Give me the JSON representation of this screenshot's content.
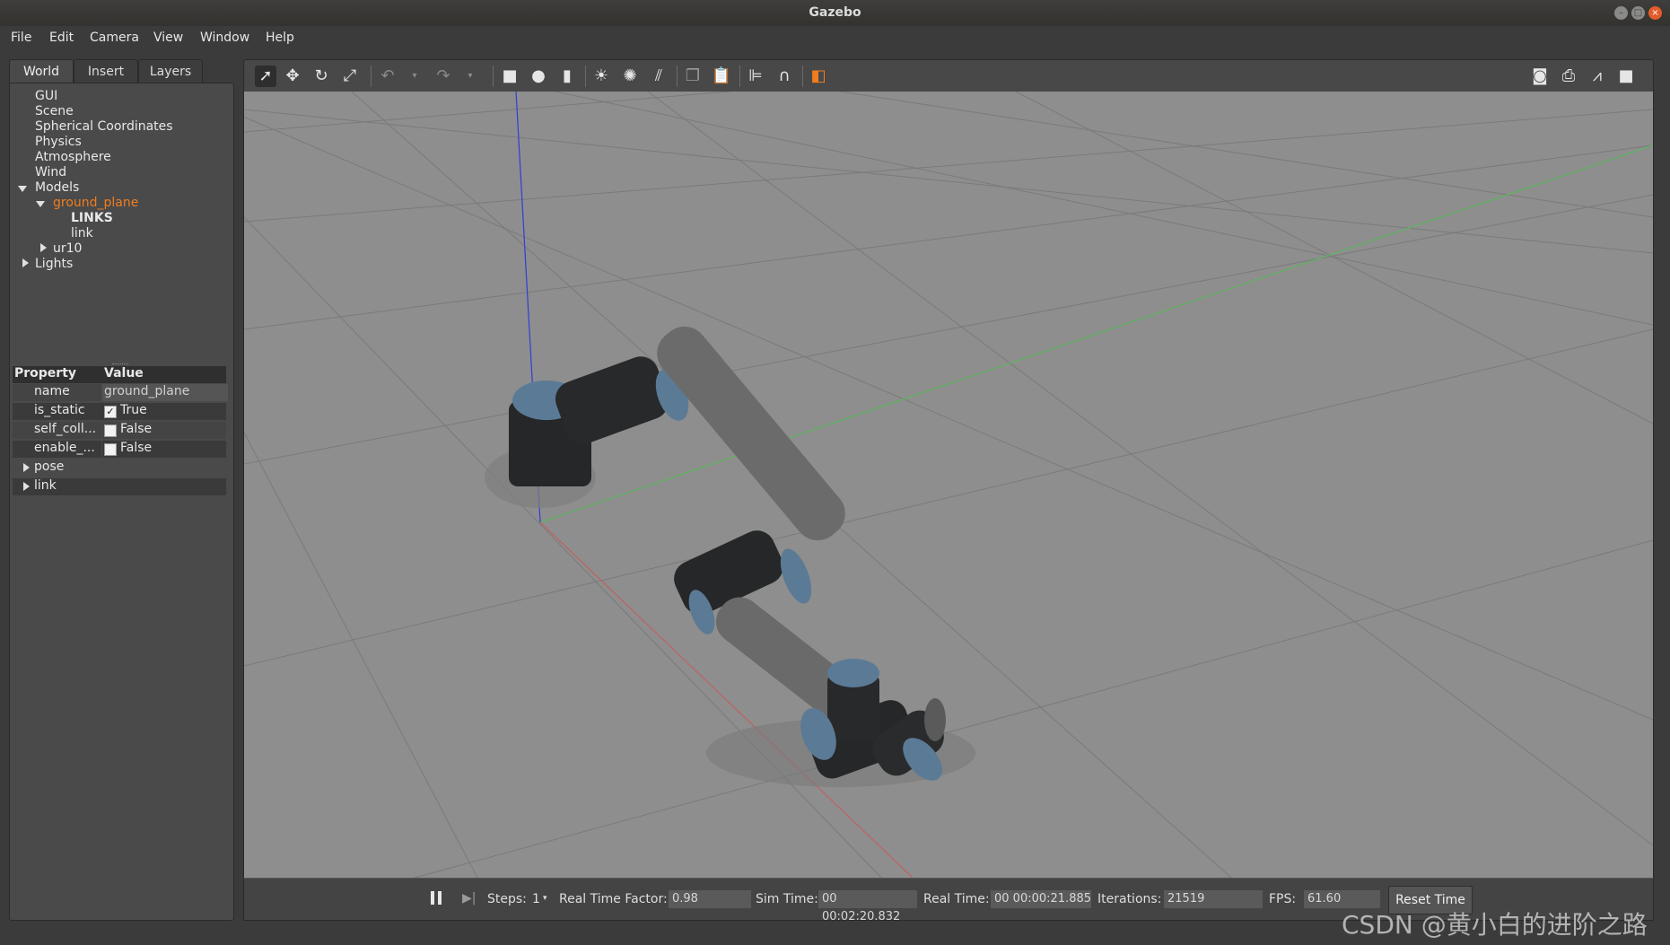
{
  "window": {
    "title": "Gazebo"
  },
  "menu": [
    "File",
    "Edit",
    "Camera",
    "View",
    "Window",
    "Help"
  ],
  "tabs": [
    "World",
    "Insert",
    "Layers"
  ],
  "tree": {
    "gui": "GUI",
    "scene": "Scene",
    "spherical": "Spherical Coordinates",
    "physics": "Physics",
    "atmosphere": "Atmosphere",
    "wind": "Wind",
    "models": "Models",
    "ground_plane": "ground_plane",
    "links_header": "LINKS",
    "link": "link",
    "ur10": "ur10",
    "lights": "Lights"
  },
  "properties": {
    "header_property": "Property",
    "header_value": "Value",
    "rows": [
      {
        "key": "name",
        "value": "ground_plane"
      },
      {
        "key": "is_static",
        "value": "True",
        "checked": true
      },
      {
        "key": "self_coll...",
        "value": "False",
        "checked": false
      },
      {
        "key": "enable_...",
        "value": "False",
        "checked": false
      }
    ],
    "pose": "pose",
    "link": "link"
  },
  "toolbar_icons": [
    "select-arrow-icon",
    "translate-icon",
    "rotate-icon",
    "scale-icon",
    "undo-icon",
    "redo-icon",
    "box-icon",
    "sphere-icon",
    "cylinder-icon",
    "point-light-icon",
    "spot-light-icon",
    "directional-light-icon",
    "copy-icon",
    "paste-icon",
    "align-icon",
    "snap-icon",
    "view-angle-icon",
    "screenshot-icon",
    "log-icon",
    "plot-icon",
    "record-video-icon"
  ],
  "bottom": {
    "steps_label": "Steps:",
    "steps_value": "1",
    "rtf_label": "Real Time Factor:",
    "rtf_value": "0.98",
    "sim_time_label": "Sim Time:",
    "sim_time_value": "00 00:02:20.832",
    "real_time_label": "Real Time:",
    "real_time_value": "00 00:00:21.885",
    "iterations_label": "Iterations:",
    "iterations_value": "21519",
    "fps_label": "FPS:",
    "fps_value": "61.60",
    "reset_label": "Reset Time"
  },
  "watermark": "CSDN @黄小白的进阶之路",
  "colors": {
    "selected_tree": "#f07d1e",
    "viewport_bg": "#8e8e8e",
    "robot_cap": "#5b7a96"
  }
}
